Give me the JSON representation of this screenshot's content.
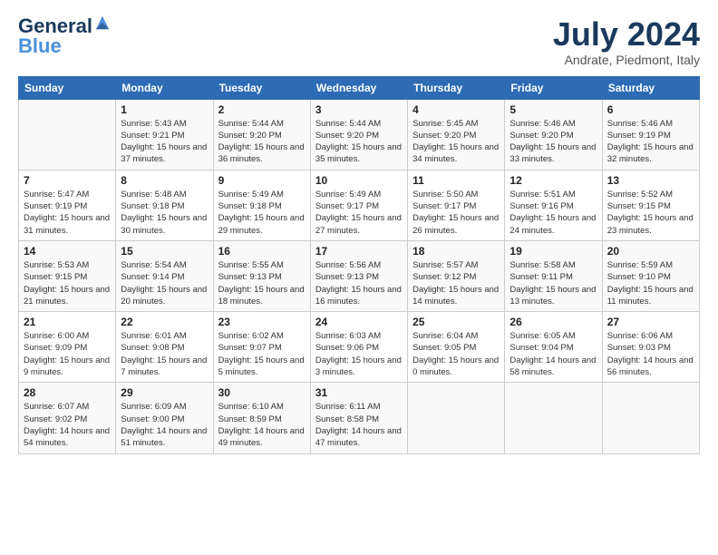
{
  "logo": {
    "text_general": "General",
    "text_blue": "Blue"
  },
  "header": {
    "month_year": "July 2024",
    "location": "Andrate, Piedmont, Italy"
  },
  "weekdays": [
    "Sunday",
    "Monday",
    "Tuesday",
    "Wednesday",
    "Thursday",
    "Friday",
    "Saturday"
  ],
  "weeks": [
    [
      {
        "day": "",
        "info": ""
      },
      {
        "day": "1",
        "info": "Sunrise: 5:43 AM\nSunset: 9:21 PM\nDaylight: 15 hours\nand 37 minutes."
      },
      {
        "day": "2",
        "info": "Sunrise: 5:44 AM\nSunset: 9:20 PM\nDaylight: 15 hours\nand 36 minutes."
      },
      {
        "day": "3",
        "info": "Sunrise: 5:44 AM\nSunset: 9:20 PM\nDaylight: 15 hours\nand 35 minutes."
      },
      {
        "day": "4",
        "info": "Sunrise: 5:45 AM\nSunset: 9:20 PM\nDaylight: 15 hours\nand 34 minutes."
      },
      {
        "day": "5",
        "info": "Sunrise: 5:46 AM\nSunset: 9:20 PM\nDaylight: 15 hours\nand 33 minutes."
      },
      {
        "day": "6",
        "info": "Sunrise: 5:46 AM\nSunset: 9:19 PM\nDaylight: 15 hours\nand 32 minutes."
      }
    ],
    [
      {
        "day": "7",
        "info": "Sunrise: 5:47 AM\nSunset: 9:19 PM\nDaylight: 15 hours\nand 31 minutes."
      },
      {
        "day": "8",
        "info": "Sunrise: 5:48 AM\nSunset: 9:18 PM\nDaylight: 15 hours\nand 30 minutes."
      },
      {
        "day": "9",
        "info": "Sunrise: 5:49 AM\nSunset: 9:18 PM\nDaylight: 15 hours\nand 29 minutes."
      },
      {
        "day": "10",
        "info": "Sunrise: 5:49 AM\nSunset: 9:17 PM\nDaylight: 15 hours\nand 27 minutes."
      },
      {
        "day": "11",
        "info": "Sunrise: 5:50 AM\nSunset: 9:17 PM\nDaylight: 15 hours\nand 26 minutes."
      },
      {
        "day": "12",
        "info": "Sunrise: 5:51 AM\nSunset: 9:16 PM\nDaylight: 15 hours\nand 24 minutes."
      },
      {
        "day": "13",
        "info": "Sunrise: 5:52 AM\nSunset: 9:15 PM\nDaylight: 15 hours\nand 23 minutes."
      }
    ],
    [
      {
        "day": "14",
        "info": "Sunrise: 5:53 AM\nSunset: 9:15 PM\nDaylight: 15 hours\nand 21 minutes."
      },
      {
        "day": "15",
        "info": "Sunrise: 5:54 AM\nSunset: 9:14 PM\nDaylight: 15 hours\nand 20 minutes."
      },
      {
        "day": "16",
        "info": "Sunrise: 5:55 AM\nSunset: 9:13 PM\nDaylight: 15 hours\nand 18 minutes."
      },
      {
        "day": "17",
        "info": "Sunrise: 5:56 AM\nSunset: 9:13 PM\nDaylight: 15 hours\nand 16 minutes."
      },
      {
        "day": "18",
        "info": "Sunrise: 5:57 AM\nSunset: 9:12 PM\nDaylight: 15 hours\nand 14 minutes."
      },
      {
        "day": "19",
        "info": "Sunrise: 5:58 AM\nSunset: 9:11 PM\nDaylight: 15 hours\nand 13 minutes."
      },
      {
        "day": "20",
        "info": "Sunrise: 5:59 AM\nSunset: 9:10 PM\nDaylight: 15 hours\nand 11 minutes."
      }
    ],
    [
      {
        "day": "21",
        "info": "Sunrise: 6:00 AM\nSunset: 9:09 PM\nDaylight: 15 hours\nand 9 minutes."
      },
      {
        "day": "22",
        "info": "Sunrise: 6:01 AM\nSunset: 9:08 PM\nDaylight: 15 hours\nand 7 minutes."
      },
      {
        "day": "23",
        "info": "Sunrise: 6:02 AM\nSunset: 9:07 PM\nDaylight: 15 hours\nand 5 minutes."
      },
      {
        "day": "24",
        "info": "Sunrise: 6:03 AM\nSunset: 9:06 PM\nDaylight: 15 hours\nand 3 minutes."
      },
      {
        "day": "25",
        "info": "Sunrise: 6:04 AM\nSunset: 9:05 PM\nDaylight: 15 hours\nand 0 minutes."
      },
      {
        "day": "26",
        "info": "Sunrise: 6:05 AM\nSunset: 9:04 PM\nDaylight: 14 hours\nand 58 minutes."
      },
      {
        "day": "27",
        "info": "Sunrise: 6:06 AM\nSunset: 9:03 PM\nDaylight: 14 hours\nand 56 minutes."
      }
    ],
    [
      {
        "day": "28",
        "info": "Sunrise: 6:07 AM\nSunset: 9:02 PM\nDaylight: 14 hours\nand 54 minutes."
      },
      {
        "day": "29",
        "info": "Sunrise: 6:09 AM\nSunset: 9:00 PM\nDaylight: 14 hours\nand 51 minutes."
      },
      {
        "day": "30",
        "info": "Sunrise: 6:10 AM\nSunset: 8:59 PM\nDaylight: 14 hours\nand 49 minutes."
      },
      {
        "day": "31",
        "info": "Sunrise: 6:11 AM\nSunset: 8:58 PM\nDaylight: 14 hours\nand 47 minutes."
      },
      {
        "day": "",
        "info": ""
      },
      {
        "day": "",
        "info": ""
      },
      {
        "day": "",
        "info": ""
      }
    ]
  ]
}
